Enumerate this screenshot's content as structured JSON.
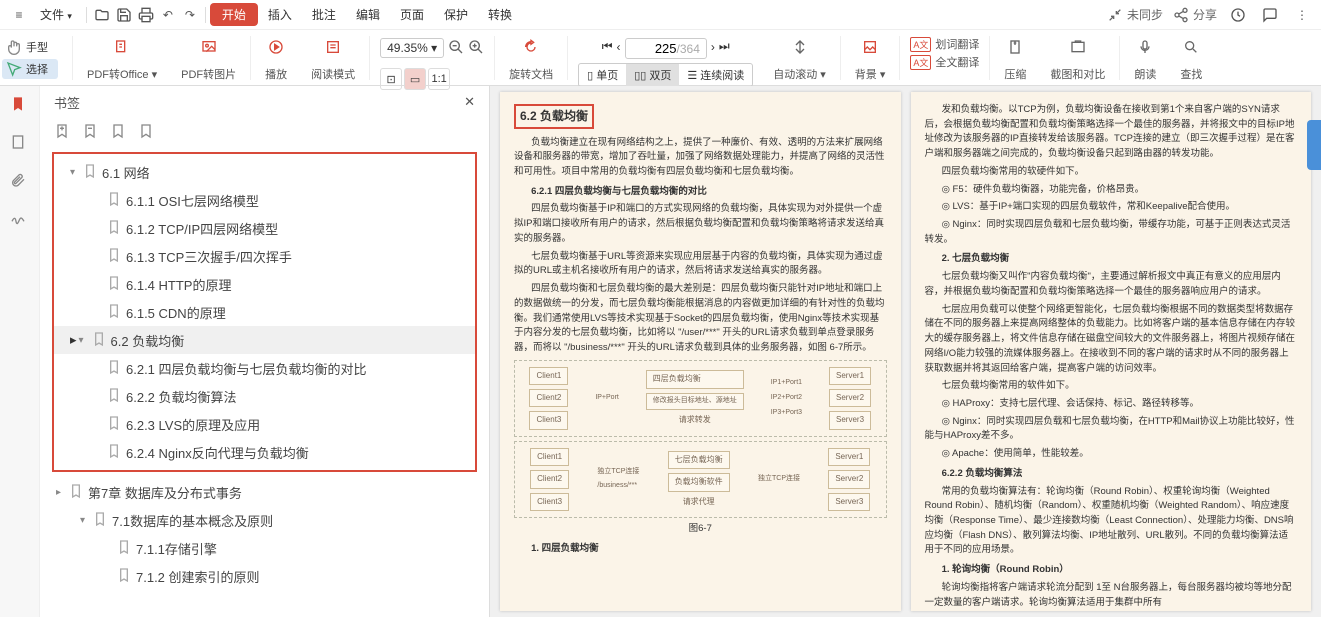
{
  "menu": {
    "file": "文件",
    "start": "开始",
    "insert": "插入",
    "annotate": "批注",
    "edit": "编辑",
    "page": "页面",
    "protect": "保护",
    "convert": "转换"
  },
  "top_right": {
    "sync": "未同步",
    "share": "分享"
  },
  "sel": {
    "hand": "手型",
    "select": "选择"
  },
  "toolbar": {
    "pdf2office": "PDF转Office",
    "pdf2img": "PDF转图片",
    "play": "播放",
    "read_mode": "阅读模式",
    "zoom": "49.35%",
    "rotate": "旋转文档",
    "single": "单页",
    "double": "双页",
    "cont": "连续阅读",
    "autoscroll": "自动滚动",
    "bg": "背景",
    "word_trans": "划词翻译",
    "full_trans": "全文翻译",
    "compress": "压缩",
    "screenshot": "截图和对比",
    "read_aloud": "朗读",
    "find": "查找"
  },
  "page_nav": {
    "current": "225",
    "total": "/364"
  },
  "sidebar": {
    "title": "书签"
  },
  "bookmarks": [
    {
      "lvl": 1,
      "caret": "▾",
      "label": "6.1 网络",
      "hl": true
    },
    {
      "lvl": 2,
      "label": "6.1.1 OSI七层网络模型",
      "hl": true
    },
    {
      "lvl": 2,
      "label": "6.1.2 TCP/IP四层网络模型",
      "hl": true
    },
    {
      "lvl": 2,
      "label": "6.1.3 TCP三次握手/四次挥手",
      "hl": true
    },
    {
      "lvl": 2,
      "label": "6.1.4 HTTP的原理",
      "hl": true
    },
    {
      "lvl": 2,
      "label": "6.1.5 CDN的原理",
      "hl": true
    },
    {
      "lvl": 1,
      "caret": "▾",
      "label": "6.2 负载均衡",
      "hl": true,
      "sel": true
    },
    {
      "lvl": 2,
      "label": "6.2.1 四层负载均衡与七层负载均衡的对比",
      "hl": true
    },
    {
      "lvl": 2,
      "label": "6.2.2 负载均衡算法",
      "hl": true
    },
    {
      "lvl": 2,
      "label": "6.2.3 LVS的原理及应用",
      "hl": true
    },
    {
      "lvl": 2,
      "label": "6.2.4 Nginx反向代理与负载均衡",
      "hl": true
    },
    {
      "lvl": 1,
      "caret": "▸",
      "label": "第7章 数据库及分布式事务"
    },
    {
      "lvl": 2,
      "caret": "▾",
      "label": "7.1数据库的基本概念及原则"
    },
    {
      "lvl": 3,
      "label": "7.1.1存储引擎"
    },
    {
      "lvl": 3,
      "label": "7.1.2 创建索引的原则"
    }
  ],
  "left_page": {
    "h": "6.2 负载均衡",
    "p1": "负载均衡建立在现有网络结构之上，提供了一种廉价、有效、透明的方法来扩展网络设备和服务器的带宽，增加了吞吐量，加强了网络数据处理能力，并提高了网络的灵活性和可用性。项目中常用的负载均衡有四层负载均衡和七层负载均衡。",
    "s1": "6.2.1 四层负载均衡与七层负载均衡的对比",
    "p2": "四层负载均衡基于IP和端口的方式实现网络的负载均衡，具体实现为对外提供一个虚拟IP和端口接收所有用户的请求，然后根据负载均衡配置和负载均衡策略将请求发送给真实的服务器。",
    "p3": "七层负载均衡基于URL等资源来实现应用层基于内容的负载均衡，具体实现为通过虚拟的URL或主机名接收所有用户的请求，然后将请求发送给真实的服务器。",
    "p4": "四层负载均衡和七层负载均衡的最大差别是：四层负载均衡只能针对IP地址和端口上的数据做统一的分发，而七层负载均衡能根据消息的内容做更加详细的有针对性的负载均衡。我们通常使用LVS等技术实现基于Socket的四层负载均衡，使用Nginx等技术实现基于内容分发的七层负载均衡，比如将以 \"/user/***\" 开头的URL请求负载到单点登录服务器，而将以 \"/business/***\" 开头的URL请求负载到具体的业务服务器，如图 6-7所示。",
    "diag1": {
      "c1": "Client1",
      "c2": "Client2",
      "c3": "Client3",
      "mid": "四层负载均衡",
      "note": "修改报头目标地址、源地址",
      "s1": "Server1",
      "s2": "Server2",
      "s3": "Server3",
      "foot": "请求转发",
      "ip1": "IP1+Port1",
      "ip2": "IP2+Port2",
      "ip3": "IP3+Port3",
      "ipi": "IP+Port"
    },
    "diag2": {
      "c1": "Client1",
      "c2": "Client2",
      "c3": "Client3",
      "mid1": "七层负载均衡",
      "mid2": "负载均衡软件",
      "s1": "Server1",
      "s2": "Server2",
      "s3": "Server3",
      "foot": "请求代理",
      "tcp": "独立TCP连接",
      "biz": "/business/***"
    },
    "fig": "图6-7",
    "s2": "1. 四层负载均衡"
  },
  "right_page": {
    "p1": "发和负载均衡。以TCP为例，负载均衡设备在接收到第1个来自客户端的SYN请求后，会根据负载均衡配置和负载均衡策略选择一个最佳的服务器，并将报文中的目标IP地址修改为该服务器的IP直接转发给该服务器。TCP连接的建立（即三次握手过程）是在客户端和服务器端之间完成的，负载均衡设备只起到路由器的转发功能。",
    "p2": "四层负载均衡常用的软硬件如下。",
    "b1": "F5：硬件负载均衡器，功能完备，价格昂贵。",
    "b2": "LVS：基于IP+端口实现的四层负载软件，常和Keepalive配合使用。",
    "b3": "Nginx：同时实现四层负载和七层负载均衡，带缓存功能，可基于正则表达式灵活转发。",
    "s1": "2. 七层负载均衡",
    "p3": "七层负载均衡又叫作\"内容负载均衡\"，主要通过解析报文中真正有意义的应用层内容，并根据负载均衡配置和负载均衡策略选择一个最佳的服务器响应用户的请求。",
    "p4": "七层应用负载可以使整个网络更智能化，七层负载均衡根据不同的数据类型将数据存储在不同的服务器上来提高网络整体的负载能力。比如将客户端的基本信息存储在内存较大的缓存服务器上，将文件信息存储在磁盘空间较大的文件服务器上，将图片视频存储在网络I/O能力较强的流媒体服务器上。在接收到不同的客户端的请求时从不同的服务器上获取数据并将其返回给客户端，提高客户端的访问效率。",
    "p5": "七层负载均衡常用的软件如下。",
    "b4": "HAProxy：支持七层代理、会话保持、标记、路径转移等。",
    "b5": "Nginx：同时实现四层负载和七层负载均衡，在HTTP和Mail协议上功能比较好，性能与HAProxy差不多。",
    "b6": "Apache：使用简单，性能较差。",
    "s2": "6.2.2 负载均衡算法",
    "p6": "常用的负载均衡算法有：轮询均衡（Round Robin）、权重轮询均衡（Weighted Round Robin）、随机均衡（Random）、权重随机均衡（Weighted Random）、响应速度均衡（Response Time）、最少连接数均衡（Least Connection）、处理能力均衡、DNS响应均衡（Flash DNS）、散列算法均衡、IP地址散列、URL散列。不同的负载均衡算法适用于不同的应用场景。",
    "s3": "1. 轮询均衡（Round Robin）",
    "p7": "轮询均衡指将客户端请求轮流分配到 1至 N台服务器上，每台服务器均被均等地分配一定数量的客户端请求。轮询均衡算法适用于集群中所有"
  }
}
